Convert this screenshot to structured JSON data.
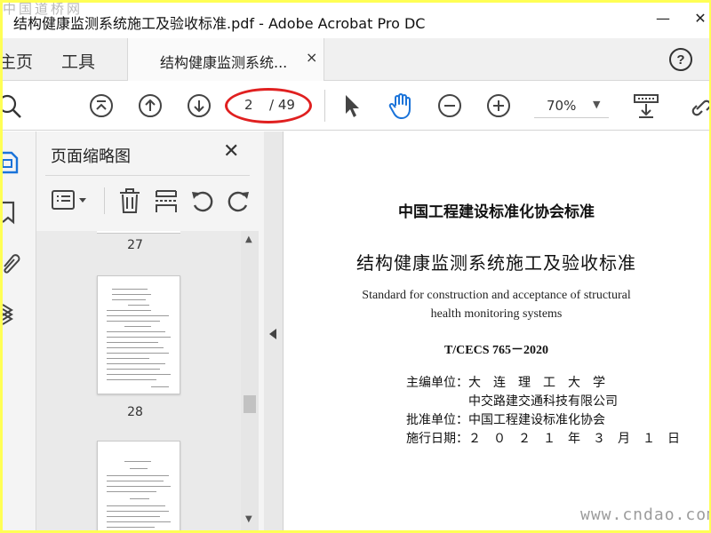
{
  "window": {
    "title": "结构健康监测系统施工及验收标准.pdf - Adobe Acrobat Pro DC",
    "minimize": "—",
    "close": "✕"
  },
  "watermarks": {
    "top_left": "中国道桥网",
    "bottom_right": "www.cndao.com"
  },
  "tabs": {
    "home": "主页",
    "tools": "工具",
    "document": "结构健康监测系统...",
    "document_close": "×"
  },
  "toolbar": {
    "page_current": "2",
    "page_total": "/ 49",
    "zoom": "70%"
  },
  "panel": {
    "title": "页面缩略图",
    "close": "✕",
    "thumbnails": [
      {
        "label": "27"
      },
      {
        "label": "28"
      }
    ]
  },
  "document": {
    "org": "中国工程建设标准化协会标准",
    "title": "结构健康监测系统施工及验收标准",
    "english_line1": "Standard for construction and acceptance of structural",
    "english_line2": "health monitoring systems",
    "code": "T/CECS 765－2020",
    "editor_label": "主编单位：",
    "editor_1": "大　连　理　工　大　学",
    "editor_2": "中交路建交通科技有限公司",
    "approver_label": "批准单位：",
    "approver": "中国工程建设标准化协会",
    "date_label": "施行日期：",
    "date": "２　０　２　１　年　３　月　１　日"
  },
  "colors": {
    "highlight_oval": "#e02020",
    "hand_tool": "#1a73d9",
    "frame": "#ffff55"
  },
  "icons": {
    "search": "search-icon",
    "first_page": "first-page-icon",
    "prev_page": "prev-page-icon",
    "next_page": "next-page-icon",
    "select": "pointer-icon",
    "hand": "hand-icon",
    "zoom_out": "zoom-out-icon",
    "zoom_in": "zoom-in-icon",
    "scroll_mode": "scroll-mode-icon",
    "link": "link-icon",
    "help": "help-icon"
  }
}
